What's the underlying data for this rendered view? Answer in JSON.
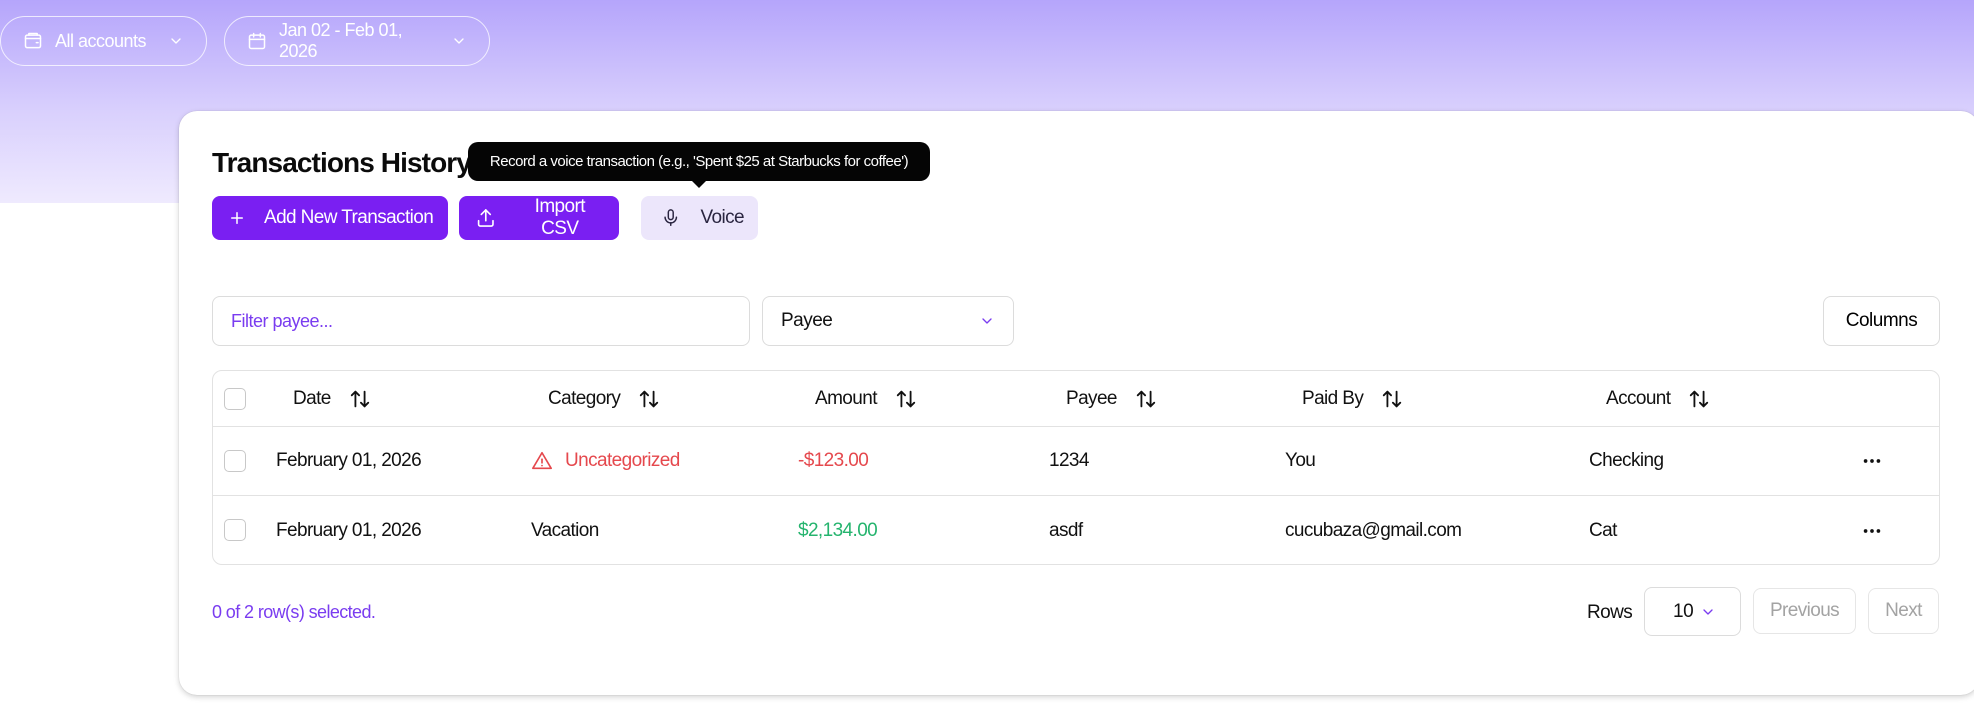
{
  "filters": {
    "accounts_label": "All accounts",
    "date_range_label": "Jan 02 - Feb 01, 2026"
  },
  "page": {
    "title": "Transactions History"
  },
  "toolbar": {
    "add_label": "Add New Transaction",
    "import_label": "Import CSV",
    "voice_label": "Voice",
    "voice_tooltip": "Record a voice transaction (e.g., 'Spent $25 at Starbucks for coffee')"
  },
  "table_controls": {
    "filter_placeholder": "Filter payee...",
    "filter_column": "Payee",
    "columns_label": "Columns"
  },
  "table": {
    "headers": [
      "Date",
      "Category",
      "Amount",
      "Payee",
      "Paid By",
      "Account"
    ],
    "rows": [
      {
        "date": "February 01, 2026",
        "category": "Uncategorized",
        "amount": "-$123.00",
        "payee": "1234",
        "paid_by": "You",
        "account": "Checking"
      },
      {
        "date": "February 01, 2026",
        "category": "Vacation",
        "amount": "$2,134.00",
        "payee": "asdf",
        "paid_by": "cucubaza@gmail.com",
        "account": "Cat"
      }
    ]
  },
  "footer": {
    "selected_text": "0 of 2 row(s) selected.",
    "rows_label": "Rows",
    "rows_per_page": "10",
    "previous_label": "Previous",
    "next_label": "Next"
  },
  "colors": {
    "accent": "#7a1ff2",
    "negative": "#e5484d",
    "positive": "#25b46e"
  }
}
